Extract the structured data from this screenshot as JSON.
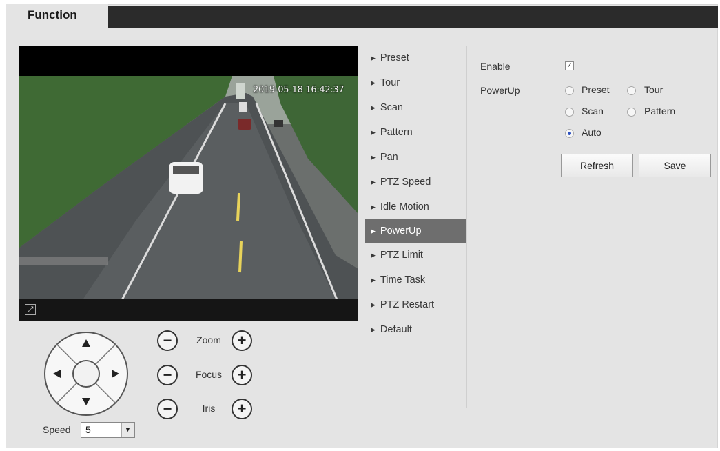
{
  "tab": {
    "label": "Function"
  },
  "video": {
    "timestamp": "2019-05-18 16:42:37"
  },
  "ptz": {
    "zoom_label": "Zoom",
    "focus_label": "Focus",
    "iris_label": "Iris",
    "minus_symbol": "−",
    "plus_symbol": "+",
    "speed_label": "Speed",
    "speed_value": "5"
  },
  "menu": {
    "items": [
      {
        "label": "Preset"
      },
      {
        "label": "Tour"
      },
      {
        "label": "Scan"
      },
      {
        "label": "Pattern"
      },
      {
        "label": "Pan"
      },
      {
        "label": "PTZ Speed"
      },
      {
        "label": "Idle Motion"
      },
      {
        "label": "PowerUp"
      },
      {
        "label": "PTZ Limit"
      },
      {
        "label": "Time Task"
      },
      {
        "label": "PTZ Restart"
      },
      {
        "label": "Default"
      }
    ],
    "active": "PowerUp"
  },
  "settings": {
    "enable_label": "Enable",
    "enable_checked": true,
    "powerup_label": "PowerUp",
    "options": [
      "Preset",
      "Tour",
      "Scan",
      "Pattern",
      "Auto"
    ],
    "selected": "Auto",
    "refresh_label": "Refresh",
    "save_label": "Save"
  },
  "icons": {
    "arrow_up": "triangle-up-icon",
    "arrow_down": "triangle-down-icon",
    "arrow_left": "triangle-left-icon",
    "arrow_right": "triangle-right-icon",
    "fullscreen": "fullscreen-icon",
    "menu_bullet": "triangle-right-small-icon"
  },
  "colors": {
    "topbar": "#2b2b2b",
    "panel_bg": "#e4e4e4",
    "menu_active": "#6e6e6e",
    "radio_selected": "#2a4fbf"
  }
}
